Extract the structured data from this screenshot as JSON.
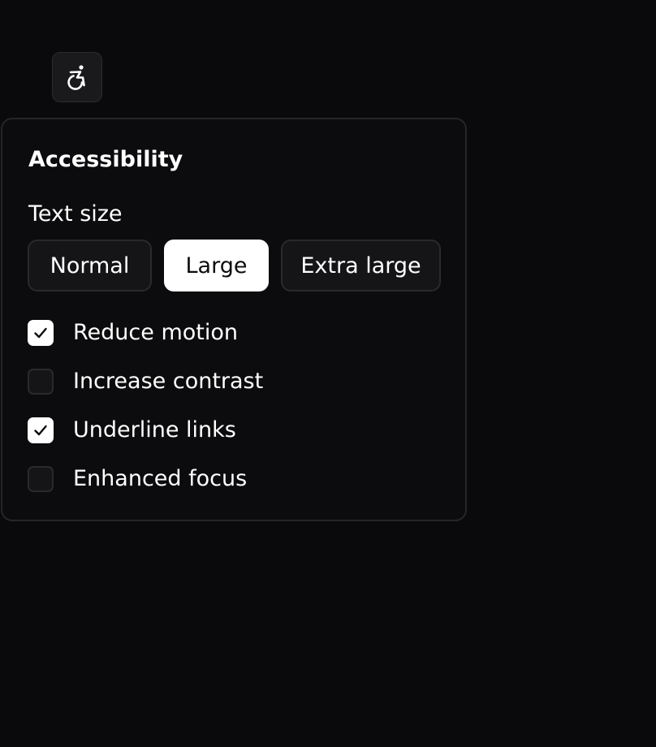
{
  "trigger": {
    "icon": "accessibility-icon"
  },
  "panel": {
    "title": "Accessibility",
    "text_size": {
      "label": "Text size",
      "options": [
        {
          "label": "Normal",
          "selected": false
        },
        {
          "label": "Large",
          "selected": true
        },
        {
          "label": "Extra large",
          "selected": false
        }
      ]
    },
    "options": [
      {
        "label": "Reduce motion",
        "checked": true
      },
      {
        "label": "Increase contrast",
        "checked": false
      },
      {
        "label": "Underline links",
        "checked": true
      },
      {
        "label": "Enhanced focus",
        "checked": false
      }
    ]
  },
  "colors": {
    "background": "#0a0a0c",
    "panel": "#0c0c0e",
    "selected": "#ffffff",
    "border": "#2a2a2e"
  }
}
